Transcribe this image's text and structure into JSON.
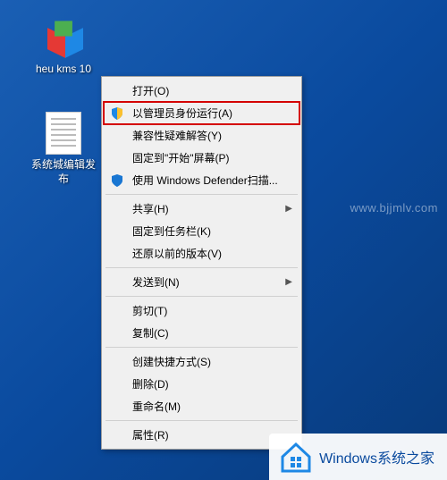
{
  "desktop": {
    "icons": [
      {
        "label": "heu kms 10"
      },
      {
        "label": "系统城编辑发布"
      }
    ]
  },
  "context_menu": {
    "items": [
      {
        "label": "打开(O)",
        "icon": null,
        "submenu": false,
        "highlight": false
      },
      {
        "label": "以管理员身份运行(A)",
        "icon": "shield",
        "submenu": false,
        "highlight": true
      },
      {
        "label": "兼容性疑难解答(Y)",
        "icon": null,
        "submenu": false,
        "highlight": false
      },
      {
        "label": "固定到\"开始\"屏幕(P)",
        "icon": null,
        "submenu": false,
        "highlight": false
      },
      {
        "label": "使用 Windows Defender扫描...",
        "icon": "defender",
        "submenu": false,
        "highlight": false
      },
      {
        "sep": true
      },
      {
        "label": "共享(H)",
        "icon": null,
        "submenu": true,
        "highlight": false
      },
      {
        "label": "固定到任务栏(K)",
        "icon": null,
        "submenu": false,
        "highlight": false
      },
      {
        "label": "还原以前的版本(V)",
        "icon": null,
        "submenu": false,
        "highlight": false
      },
      {
        "sep": true
      },
      {
        "label": "发送到(N)",
        "icon": null,
        "submenu": true,
        "highlight": false
      },
      {
        "sep": true
      },
      {
        "label": "剪切(T)",
        "icon": null,
        "submenu": false,
        "highlight": false
      },
      {
        "label": "复制(C)",
        "icon": null,
        "submenu": false,
        "highlight": false
      },
      {
        "sep": true
      },
      {
        "label": "创建快捷方式(S)",
        "icon": null,
        "submenu": false,
        "highlight": false
      },
      {
        "label": "删除(D)",
        "icon": null,
        "submenu": false,
        "highlight": false
      },
      {
        "label": "重命名(M)",
        "icon": null,
        "submenu": false,
        "highlight": false
      },
      {
        "sep": true
      },
      {
        "label": "属性(R)",
        "icon": null,
        "submenu": false,
        "highlight": false
      }
    ]
  },
  "watermarks": {
    "url": "www.bjjmlv.com",
    "brand": "Windows系统之家"
  }
}
